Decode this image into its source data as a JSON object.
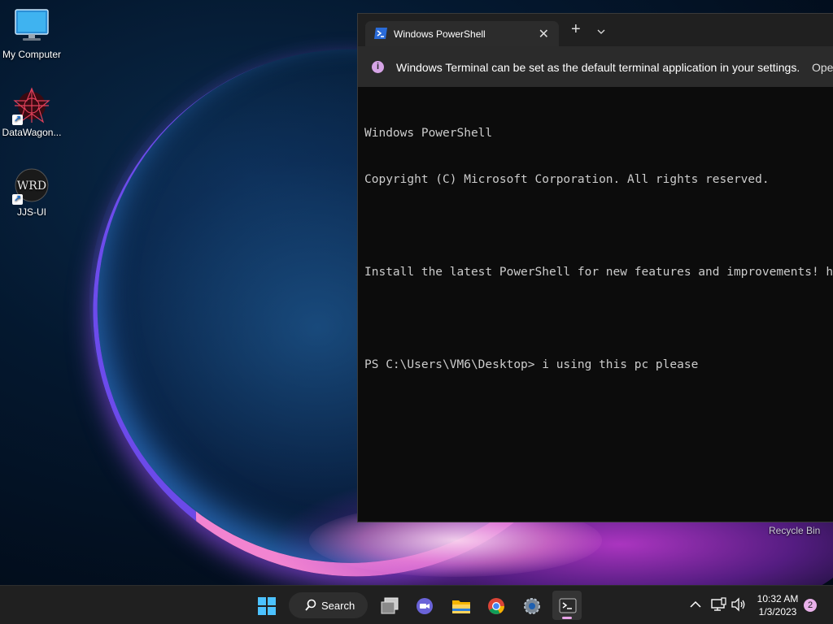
{
  "desktop": {
    "icons": [
      {
        "label": "My Computer"
      },
      {
        "label": "DataWagon..."
      },
      {
        "label": "JJS-UI",
        "icon_text": "WRD"
      }
    ],
    "recycle_bin_label": "Recycle Bin"
  },
  "terminal": {
    "tab_title": "Windows PowerShell",
    "close_symbol": "✕",
    "new_tab_symbol": "+",
    "infobar_text": "Windows Terminal can be set as the default terminal application in your settings.",
    "infobar_link": "Ope",
    "console_lines": [
      "Windows PowerShell",
      "Copyright (C) Microsoft Corporation. All rights reserved.",
      "",
      "Install the latest PowerShell for new features and improvements! https://aka.ms/PSWindows",
      "",
      "PS C:\\Users\\VM6\\Desktop> i using this pc please"
    ]
  },
  "taskbar": {
    "search_label": "Search",
    "apps": [
      "start-icon",
      "task-view-icon",
      "teams-chat-icon",
      "file-explorer-icon",
      "chrome-icon",
      "settings-icon",
      "terminal-icon"
    ],
    "active_app": "terminal-icon",
    "clock_time": "10:32 AM",
    "clock_date": "1/3/2023",
    "notification_count": "2"
  },
  "colors": {
    "accent": "#e8a4e8",
    "terminal_bg": "#0c0c0c",
    "taskbar_bg": "#202020"
  }
}
